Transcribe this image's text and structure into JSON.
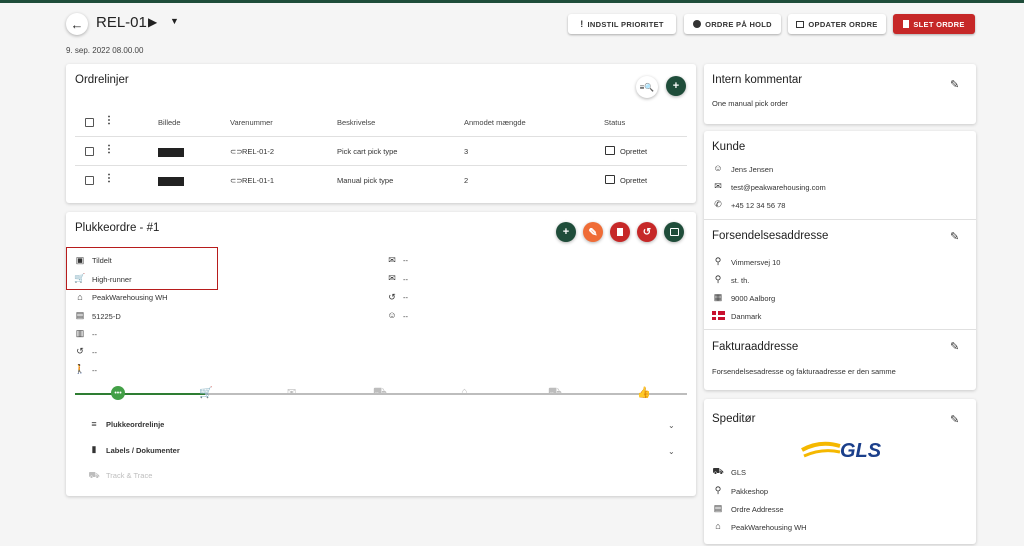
{
  "header": {
    "title": "REL-01",
    "date": "9. sep. 2022 08.00.00",
    "buttons": {
      "priority": "INDSTIL PRIORITET",
      "hold": "ORDRE PÅ HOLD",
      "update": "OPDATER ORDRE",
      "delete": "SLET ORDRE"
    }
  },
  "orderlines": {
    "title": "Ordrelinjer",
    "columns": [
      "Billede",
      "Varenummer",
      "Beskrivelse",
      "Anmodet mængde",
      "Status"
    ],
    "rows": [
      {
        "sku": "REL-01-2",
        "description": "Pick cart pick type",
        "qty": "3",
        "status": "Oprettet"
      },
      {
        "sku": "REL-01-1",
        "description": "Manual pick type",
        "qty": "2",
        "status": "Oprettet"
      }
    ]
  },
  "pickorder": {
    "title": "Plukkeordre - #1",
    "left": {
      "assigned": "Tildelt",
      "runner": "High-runner",
      "warehouse": "PeakWarehousing WH",
      "location": "51225-D",
      "archive": "--",
      "history": "--",
      "person": "--"
    },
    "right": {
      "mail1": "--",
      "mail2": "--",
      "history": "--",
      "person": "--"
    },
    "sections": {
      "lines": "Plukkeordrelinje",
      "labels": "Labels / Dokumenter",
      "track": "Track & Trace"
    }
  },
  "comment": {
    "title": "Intern kommentar",
    "text": "One manual pick order"
  },
  "customer": {
    "title": "Kunde",
    "name": "Jens Jensen",
    "email": "test@peakwarehousing.com",
    "phone": "+45 12 34 56 78"
  },
  "shipping": {
    "title": "Forsendelsesaddresse",
    "street": "Vimmersvej 10",
    "floor": "st. th.",
    "city": "9000 Aalborg",
    "country": "Danmark"
  },
  "billing": {
    "title": "Fakturaaddresse",
    "text": "Forsendelsesadresse og fakturaadresse er den samme"
  },
  "carrier": {
    "title": "Speditør",
    "logo": "GLS",
    "name": "GLS",
    "type": "Pakkeshop",
    "address": "Ordre Addresse",
    "warehouse": "PeakWarehousing WH"
  },
  "colors": {
    "brand_green": "#1f4d3a",
    "delete_red": "#c62828",
    "edit_orange": "#ef6c36",
    "highlight_border": "#b71c1c",
    "gls_yellow": "#f5b800",
    "gls_blue": "#1b3f8b"
  }
}
